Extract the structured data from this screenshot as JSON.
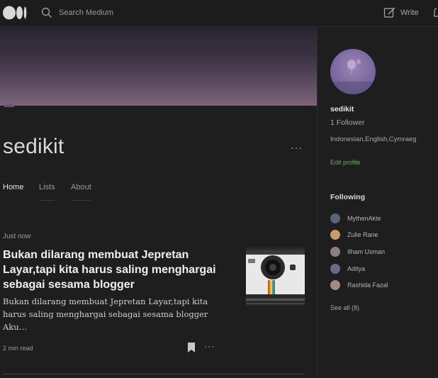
{
  "topbar": {
    "logo_icon": "medium-logo-icon",
    "search_placeholder": "Search Medium",
    "write_label": "Write"
  },
  "profile": {
    "name": "sedikit",
    "more_icon": "more-dots-icon",
    "more_glyph": "···"
  },
  "tabs": [
    {
      "label": "Home",
      "active": true
    },
    {
      "label": "Lists",
      "active": false
    },
    {
      "label": "About",
      "active": false
    }
  ],
  "post": {
    "time": "Just now",
    "title": "Bukan dilarang membuat Jepretan Layar,tapi kita harus saling menghargai sebagai sesama blogger",
    "excerpt": "Bukan dilarang membuat Jepretan Layar,tapi kita harus saling menghargai sebagai sesama blogger Aku…",
    "read_time": "2 min read",
    "more_glyph": "···",
    "thumbnail": "camera-thumbnail-image"
  },
  "sidebar": {
    "name": "sedikit",
    "followers": "1 Follower",
    "bio": "Indonesian,English,Cymraeg",
    "edit_profile": "Edit profile",
    "following_heading": "Following",
    "following": [
      {
        "name": "MythenAkte",
        "avatar_color": "#5a6478"
      },
      {
        "name": "Zulie Rane",
        "avatar_color": "#c99a6a"
      },
      {
        "name": "Ilham Usman",
        "avatar_color": "#8a7f7a"
      },
      {
        "name": "Aditya",
        "avatar_color": "#6e6a86"
      },
      {
        "name": "Rashida Fazal",
        "avatar_color": "#a48a80"
      }
    ],
    "see_all": "See all (8)"
  },
  "colors": {
    "background": "#1e1e1e",
    "accent_green": "#58b86a"
  }
}
